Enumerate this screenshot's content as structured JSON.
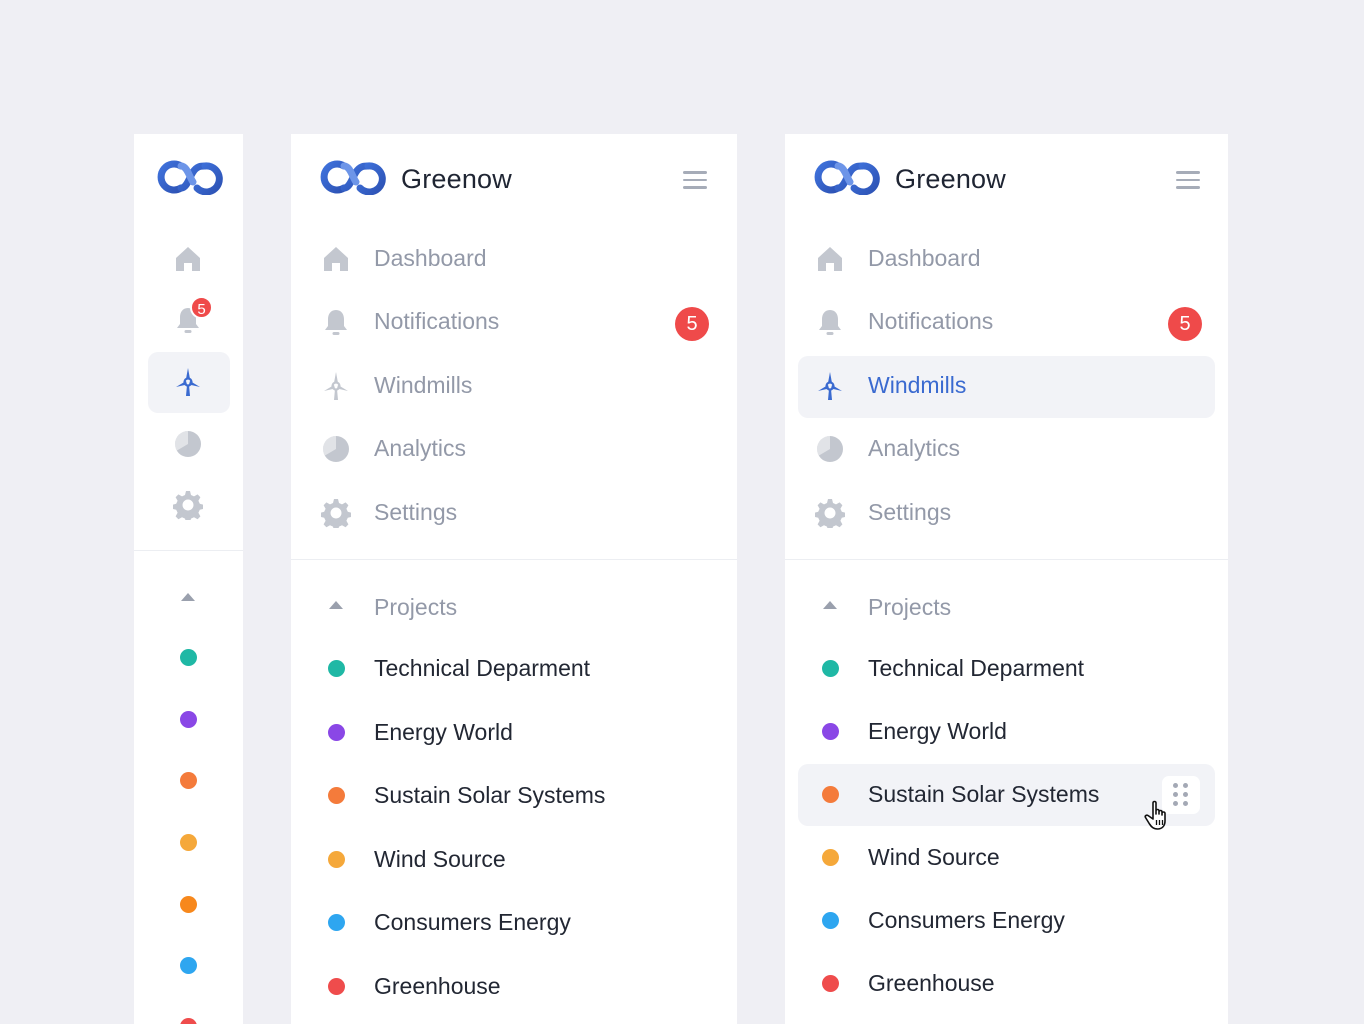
{
  "brand": {
    "name": "Greenow",
    "logo_colors": [
      "#2f5dc4",
      "#4a7de0"
    ]
  },
  "nav": {
    "items": [
      {
        "id": "dashboard",
        "label": "Dashboard",
        "icon": "home-icon"
      },
      {
        "id": "notifications",
        "label": "Notifications",
        "icon": "bell-icon",
        "badge": "5"
      },
      {
        "id": "windmills",
        "label": "Windmills",
        "icon": "windmill-icon"
      },
      {
        "id": "analytics",
        "label": "Analytics",
        "icon": "pie-chart-icon"
      },
      {
        "id": "settings",
        "label": "Settings",
        "icon": "gear-icon"
      }
    ],
    "active_in_expanded_panel": "windmills"
  },
  "projects": {
    "header": "Projects",
    "items": [
      {
        "label": "Technical Deparment",
        "color": "#1fb8a5"
      },
      {
        "label": "Energy World",
        "color": "#8a47e6"
      },
      {
        "label": "Sustain Solar Systems",
        "color": "#f47b3b"
      },
      {
        "label": "Wind Source",
        "color": "#f5a83a"
      },
      {
        "label": "Consumers Energy",
        "color": "#2ea6f0"
      },
      {
        "label": "Greenhouse",
        "color": "#ef4c4c"
      }
    ],
    "collapsed_dot_colors": [
      "#1fb8a5",
      "#8a47e6",
      "#f47b3b",
      "#f5a83a",
      "#f7881c",
      "#2ea6f0",
      "#ef4c4c"
    ],
    "hovered_item": "Sustain Solar Systems"
  },
  "colors": {
    "background": "#efeff4",
    "panel": "#ffffff",
    "accent": "#3a6ad0",
    "muted_text": "#9399a8",
    "icon_gray": "#c3c7cf",
    "badge": "#ef4a4a"
  }
}
